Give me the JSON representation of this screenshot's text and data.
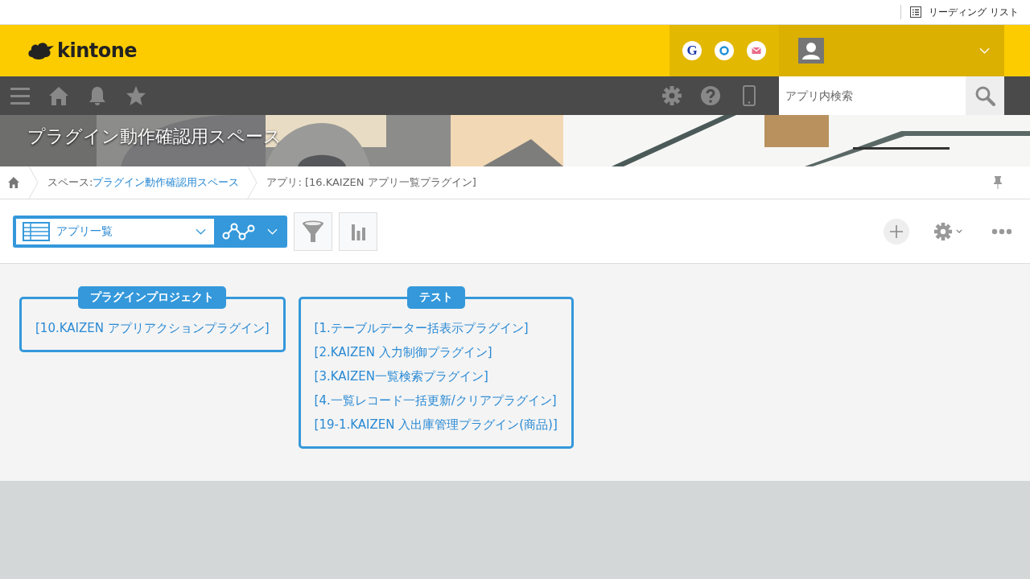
{
  "browser_bar": {
    "reading_list": "リーディング リスト"
  },
  "header": {
    "logo": "kintone",
    "app_icons": [
      {
        "kind": "letter",
        "label": "G"
      },
      {
        "kind": "ring"
      },
      {
        "kind": "mail"
      }
    ]
  },
  "nav": {
    "search": {
      "placeholder": "アプリ内検索"
    }
  },
  "space": {
    "title": "プラグイン動作確認用スペース"
  },
  "breadcrumb": [
    {
      "label": "スペース:",
      "link": "プラグイン動作確認用スペース"
    },
    {
      "label": "アプリ: [16.KAIZEN アプリ一覧プラグイン]"
    }
  ],
  "view_selector": {
    "label": "アプリ一覧"
  },
  "groups": [
    {
      "title": "プラグインプロジェクト",
      "apps": [
        "[10.KAIZEN アプリアクションプラグイン]"
      ]
    },
    {
      "title": "テスト",
      "apps": [
        "[1.テーブルデーター括表示プラグイン]",
        "[2.KAIZEN 入力制御プラグイン]",
        "[3.KAIZEN一覧検索プラグイン]",
        "[4.一覧レコード一括更新/クリアプラグイン]",
        "[19-1.KAIZEN 入出庫管理プラグイン(商品)]"
      ]
    }
  ]
}
